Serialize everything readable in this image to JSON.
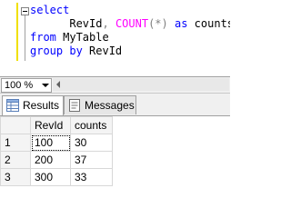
{
  "editor": {
    "lines": [
      [
        {
          "t": "select",
          "c": "kw"
        }
      ],
      [
        {
          "t": "      RevId",
          "c": "plain"
        },
        {
          "t": ",",
          "c": "op"
        },
        {
          "t": " ",
          "c": "plain"
        },
        {
          "t": "COUNT",
          "c": "fn"
        },
        {
          "t": "(*)",
          "c": "op"
        },
        {
          "t": " ",
          "c": "plain"
        },
        {
          "t": "as",
          "c": "kw"
        },
        {
          "t": " counts",
          "c": "plain"
        }
      ],
      [
        {
          "t": "from",
          "c": "kw"
        },
        {
          "t": " MyTable",
          "c": "plain"
        }
      ],
      [
        {
          "t": "group",
          "c": "kw"
        },
        {
          "t": " ",
          "c": "plain"
        },
        {
          "t": "by",
          "c": "kw"
        },
        {
          "t": " RevId",
          "c": "plain"
        }
      ]
    ]
  },
  "zoom": {
    "value": "100 %"
  },
  "tabs": [
    {
      "label": "Results",
      "icon": "results-grid-icon",
      "active": true
    },
    {
      "label": "Messages",
      "icon": "messages-icon",
      "active": false
    }
  ],
  "results": {
    "columns": [
      "RevId",
      "counts"
    ],
    "rows": [
      {
        "num": "1",
        "cells": [
          "100",
          "30"
        ]
      },
      {
        "num": "2",
        "cells": [
          "200",
          "37"
        ]
      },
      {
        "num": "3",
        "cells": [
          "300",
          "33"
        ]
      }
    ]
  }
}
